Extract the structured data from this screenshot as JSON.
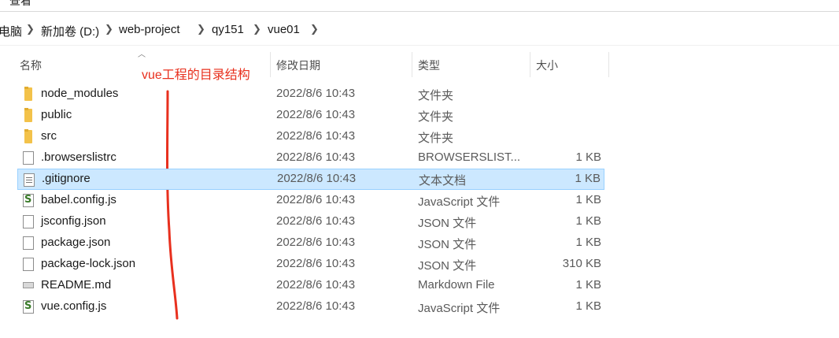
{
  "menu": {
    "view_label": "查看"
  },
  "breadcrumb": [
    "电脑",
    "新加卷 (D:)",
    "web-project",
    "qy151",
    "vue01"
  ],
  "columns": {
    "name": "名称",
    "date": "修改日期",
    "type": "类型",
    "size": "大小"
  },
  "annotation": "vue工程的目录结构",
  "colors": {
    "selection_bg": "#cce8ff",
    "selection_border": "#99d1ff",
    "annotation": "#e8301e",
    "folder": "#f3c24a"
  },
  "files": [
    {
      "name": "node_modules",
      "date": "2022/8/6 10:43",
      "type": "文件夹",
      "size": "",
      "icon": "folder-icon"
    },
    {
      "name": "public",
      "date": "2022/8/6 10:43",
      "type": "文件夹",
      "size": "",
      "icon": "folder-icon"
    },
    {
      "name": "src",
      "date": "2022/8/6 10:43",
      "type": "文件夹",
      "size": "",
      "icon": "folder-icon"
    },
    {
      "name": ".browserslistrc",
      "date": "2022/8/6 10:43",
      "type": "BROWSERSLIST...",
      "size": "1 KB",
      "icon": "file-icon"
    },
    {
      "name": ".gitignore",
      "date": "2022/8/6 10:43",
      "type": "文本文档",
      "size": "1 KB",
      "icon": "text-file-icon",
      "selected": true
    },
    {
      "name": "babel.config.js",
      "date": "2022/8/6 10:43",
      "type": "JavaScript 文件",
      "size": "1 KB",
      "icon": "js-file-icon"
    },
    {
      "name": "jsconfig.json",
      "date": "2022/8/6 10:43",
      "type": "JSON 文件",
      "size": "1 KB",
      "icon": "file-icon"
    },
    {
      "name": "package.json",
      "date": "2022/8/6 10:43",
      "type": "JSON 文件",
      "size": "1 KB",
      "icon": "file-icon"
    },
    {
      "name": "package-lock.json",
      "date": "2022/8/6 10:43",
      "type": "JSON 文件",
      "size": "310 KB",
      "icon": "file-icon"
    },
    {
      "name": "README.md",
      "date": "2022/8/6 10:43",
      "type": "Markdown File",
      "size": "1 KB",
      "icon": "markdown-file-icon"
    },
    {
      "name": "vue.config.js",
      "date": "2022/8/6 10:43",
      "type": "JavaScript 文件",
      "size": "1 KB",
      "icon": "js-file-icon"
    }
  ]
}
